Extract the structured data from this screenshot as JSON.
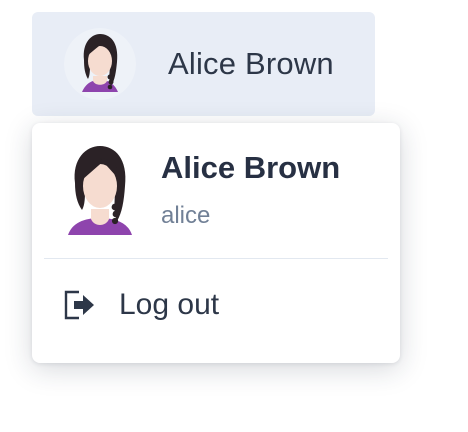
{
  "user_trigger": {
    "name": "Alice Brown",
    "avatar_icon": "female-avatar-icon"
  },
  "dropdown": {
    "name": "Alice Brown",
    "username": "alice",
    "avatar_icon": "female-avatar-icon",
    "logout": {
      "label": "Log out",
      "icon": "logout-icon"
    }
  },
  "colors": {
    "trigger_background": "#e8edf6",
    "text": "#2d3748",
    "muted_text": "#718096",
    "avatar_shirt": "#8e44ad",
    "avatar_hair": "#2b2226",
    "avatar_skin": "#f6dcd0"
  }
}
